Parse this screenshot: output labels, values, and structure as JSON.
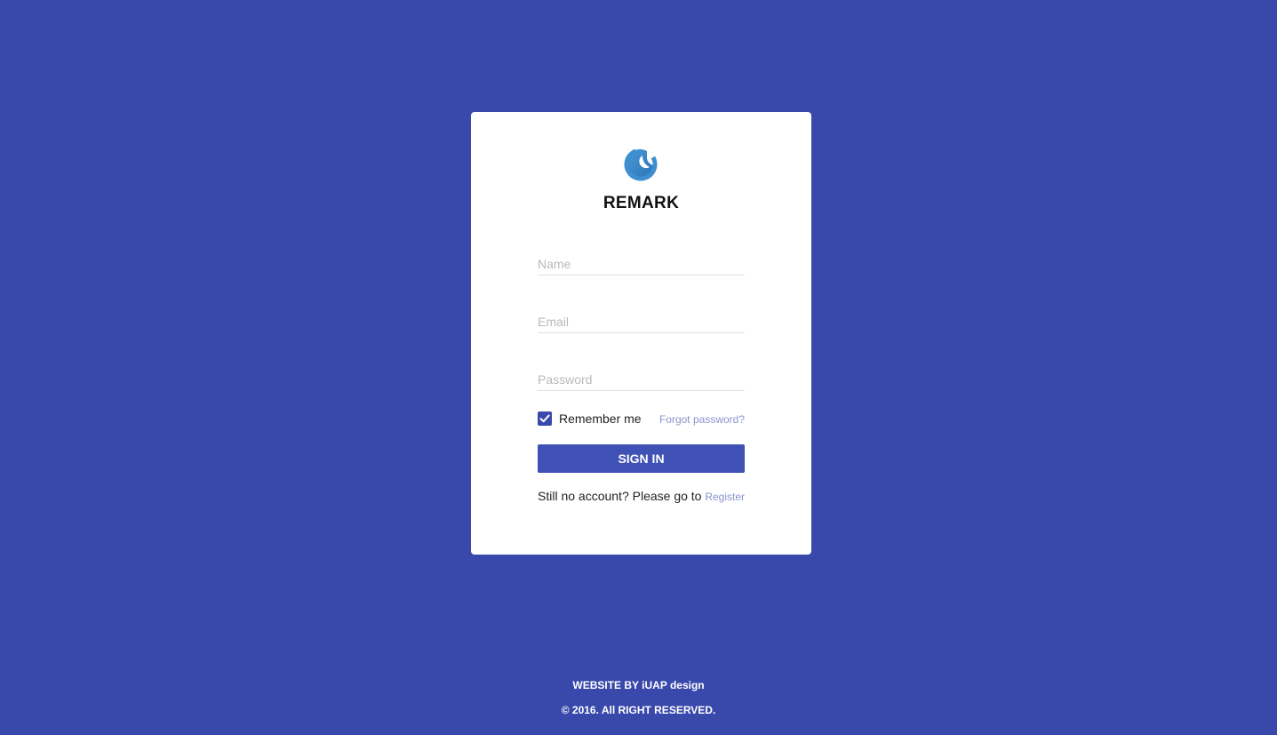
{
  "brand": {
    "logo_icon": "crescent-moon-logo-icon",
    "name": "REMARK",
    "logo_colors": [
      "#3c8fce",
      "#1f6fb2"
    ]
  },
  "form": {
    "name_placeholder": "Name",
    "email_placeholder": "Email",
    "password_placeholder": "Password",
    "name_value": "",
    "email_value": "",
    "password_value": "",
    "remember_label": "Remember me",
    "remember_checked": true,
    "forgot_label": "Forgot password?",
    "signin_label": "SIGN IN",
    "register_prompt": "Still no account? Please go to ",
    "register_link": "Register"
  },
  "footer": {
    "credit": "WEBSITE BY iUAP design",
    "copyright": "© 2016. All RIGHT RESERVED."
  },
  "colors": {
    "background": "#3949ab",
    "primary_button": "#3f51b5",
    "link": "#8c93d1"
  }
}
